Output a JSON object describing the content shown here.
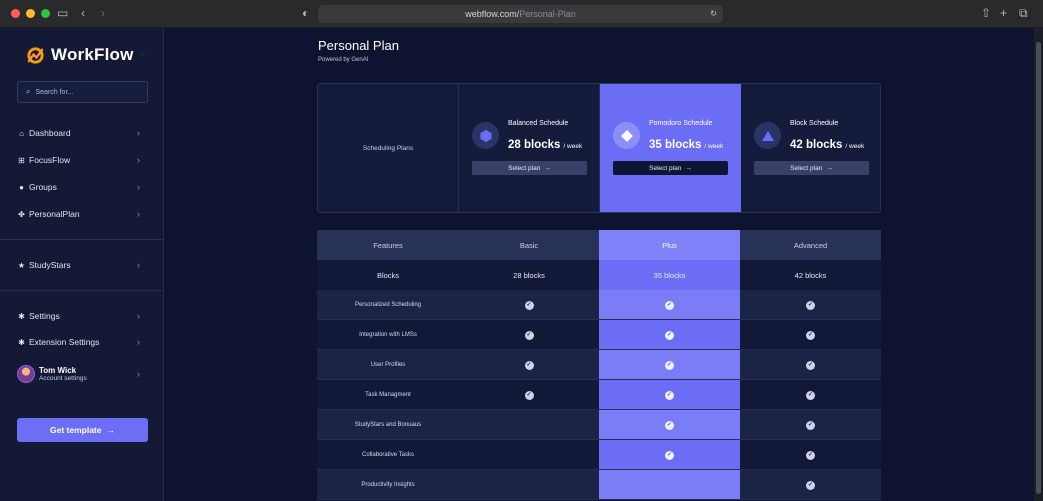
{
  "browser": {
    "url_host": "webflow.com/",
    "url_path": "Personal-Plan"
  },
  "sidebar": {
    "brand": "WorkFlow",
    "search_placeholder": "Search for...",
    "items_top": [
      {
        "label": "Dashboard",
        "icon": "home-icon"
      },
      {
        "label": "FocusFlow",
        "icon": "grid-icon"
      },
      {
        "label": "Groups",
        "icon": "user-icon"
      },
      {
        "label": "PersonalPlan",
        "icon": "puzzle-icon"
      }
    ],
    "items_mid": [
      {
        "label": "StudyStars",
        "icon": "star-icon"
      }
    ],
    "items_bottom": [
      {
        "label": "Settings",
        "icon": "gear-icon"
      },
      {
        "label": "Extension Settings",
        "icon": "gear-icon"
      }
    ],
    "user": {
      "name": "Tom Wick",
      "subtitle": "Account settings"
    },
    "cta_label": "Get template"
  },
  "page": {
    "title": "Personal Plan",
    "subtitle": "Powered by GenAI"
  },
  "plans": {
    "row_label": "Scheduling Plans",
    "items": [
      {
        "name": "Balanced Schedule",
        "blocks": "28 blocks",
        "per": "/ week",
        "button": "Select plan",
        "icon": "hexagon-icon"
      },
      {
        "name": "Pomodoro Schedule",
        "blocks": "35 blocks",
        "per": "/ week",
        "button": "Select plan",
        "icon": "diamond-icon"
      },
      {
        "name": "Block Schedule",
        "blocks": "42 blocks",
        "per": "/ week",
        "button": "Select plan",
        "icon": "triangle-icon"
      }
    ]
  },
  "features": {
    "headers": [
      "Features",
      "Basic",
      "Plus",
      "Advanced"
    ],
    "blocks_row": [
      "Blocks",
      "28 blocks",
      "35 blocks",
      "42 blocks"
    ],
    "rows": [
      {
        "name": "Personalized Scheduling",
        "basic": true,
        "plus": true,
        "advanced": true
      },
      {
        "name": "Integration with LMSs",
        "basic": true,
        "plus": true,
        "advanced": true
      },
      {
        "name": "User Profiles",
        "basic": true,
        "plus": true,
        "advanced": true
      },
      {
        "name": "Task Managment",
        "basic": true,
        "plus": true,
        "advanced": true
      },
      {
        "name": "StudyStars and Bonuaus",
        "basic": false,
        "plus": true,
        "advanced": true
      },
      {
        "name": "Collaborative Tasks",
        "basic": false,
        "plus": true,
        "advanced": true
      },
      {
        "name": "Productivity Insights",
        "basic": false,
        "plus": false,
        "advanced": true
      }
    ]
  },
  "colors": {
    "accent": "#6b6ef4",
    "background": "#0e1430",
    "sidebar": "#141a35"
  }
}
